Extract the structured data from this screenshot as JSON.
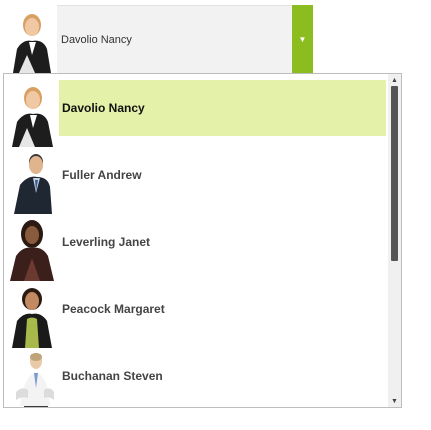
{
  "combo": {
    "selected_value": "Davolio Nancy",
    "arrow_icon": "chevron-down-icon",
    "accent_color": "#8cbd20"
  },
  "dropdown": {
    "items": [
      {
        "label": "Davolio Nancy",
        "photo": "employee-photo-davolio-nancy",
        "selected": true
      },
      {
        "label": "Fuller Andrew",
        "photo": "employee-photo-fuller-andrew",
        "selected": false
      },
      {
        "label": "Leverling Janet",
        "photo": "employee-photo-leverling-janet",
        "selected": false
      },
      {
        "label": "Peacock Margaret",
        "photo": "employee-photo-peacock-margaret",
        "selected": false
      },
      {
        "label": "Buchanan Steven",
        "photo": "employee-photo-buchanan-steven",
        "selected": false
      }
    ],
    "highlight_color": "#e4f1a8"
  },
  "scrollbar": {
    "up_icon": "chevron-up-icon",
    "down_icon": "chevron-down-icon"
  }
}
